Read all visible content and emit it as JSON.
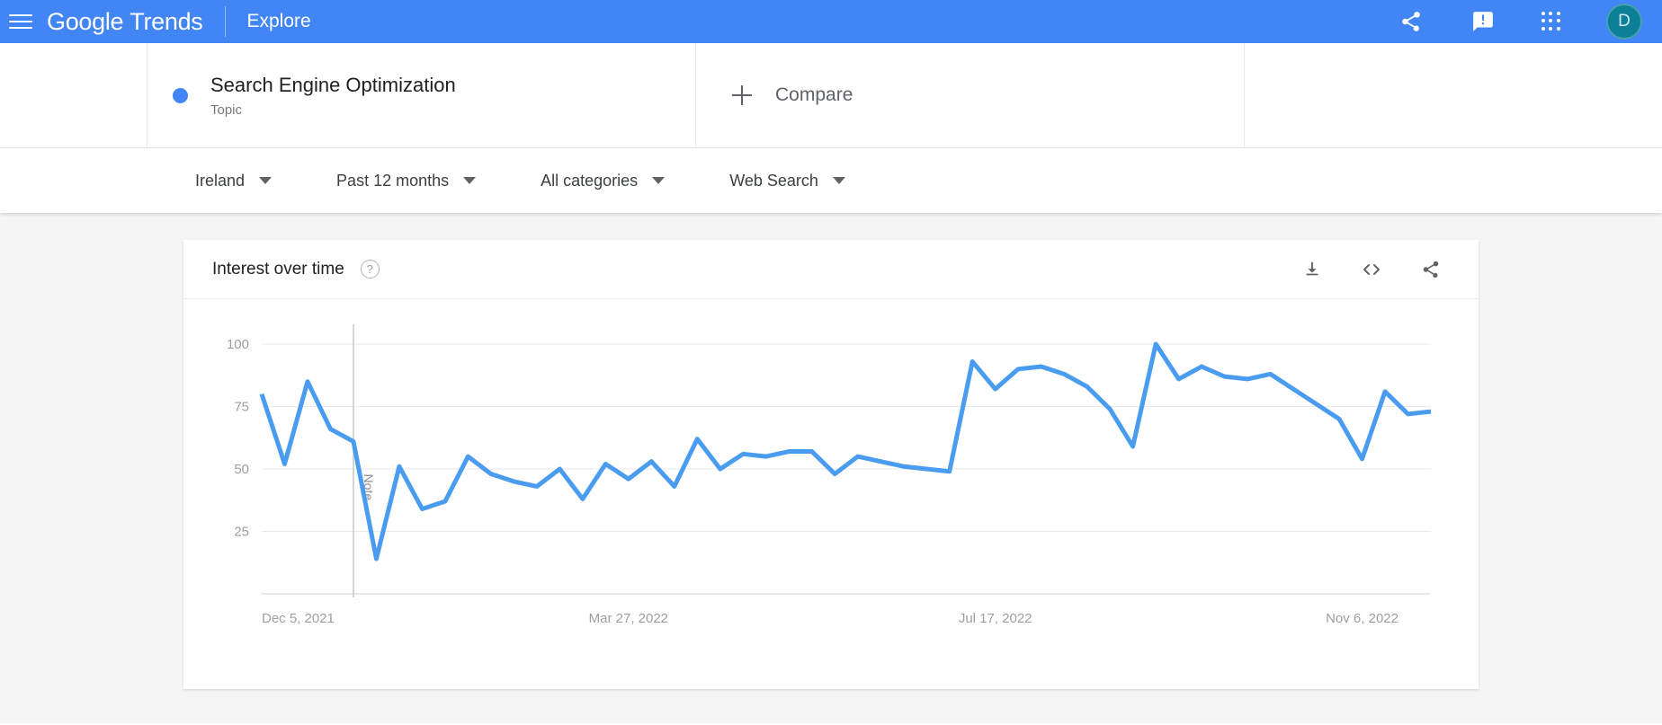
{
  "appbar": {
    "menu_icon": "hamburger-menu-icon",
    "brand_google": "Google",
    "brand_product": "Trends",
    "explore_label": "Explore",
    "share_icon": "share-icon",
    "feedback_icon": "feedback-icon",
    "apps_icon": "apps-grid-icon",
    "avatar_initial": "D",
    "background_color": "#4285f4",
    "avatar_color": "#0b8096"
  },
  "query": {
    "term_color": "#4285f4",
    "term_title": "Search Engine Optimization",
    "term_subtitle": "Topic",
    "compare_label": "Compare",
    "add_icon": "plus-icon"
  },
  "filters": [
    {
      "label": "Ireland",
      "icon": "chevron-down-icon"
    },
    {
      "label": "Past 12 months",
      "icon": "chevron-down-icon"
    },
    {
      "label": "All categories",
      "icon": "chevron-down-icon"
    },
    {
      "label": "Web Search",
      "icon": "chevron-down-icon"
    }
  ],
  "card": {
    "title": "Interest over time",
    "help_icon": "help-circle-icon",
    "help_glyph": "?",
    "download_icon": "download-icon",
    "embed_icon": "embed-code-icon",
    "share_icon": "share-icon"
  },
  "chart_data": {
    "type": "line",
    "title": "Interest over time",
    "xlabel": "",
    "ylabel": "",
    "ylim": [
      0,
      100
    ],
    "yticks": [
      100,
      75,
      50,
      25
    ],
    "grid": true,
    "legend": false,
    "line_color": "#4a9cf0",
    "xticks": [
      "Dec 5, 2021",
      "Mar 27, 2022",
      "Jul 17, 2022",
      "Nov 6, 2022"
    ],
    "xtick_indices": [
      0,
      16,
      32,
      48
    ],
    "annotation": {
      "label": "Note",
      "index": 4
    },
    "x": [
      "Dec 5, 2021",
      "Dec 12, 2021",
      "Dec 19, 2021",
      "Dec 26, 2021",
      "Jan 2, 2022",
      "Jan 9, 2022",
      "Jan 16, 2022",
      "Jan 23, 2022",
      "Jan 30, 2022",
      "Feb 6, 2022",
      "Feb 13, 2022",
      "Feb 20, 2022",
      "Feb 27, 2022",
      "Mar 6, 2022",
      "Mar 13, 2022",
      "Mar 20, 2022",
      "Mar 27, 2022",
      "Apr 3, 2022",
      "Apr 10, 2022",
      "Apr 17, 2022",
      "Apr 24, 2022",
      "May 1, 2022",
      "May 8, 2022",
      "May 15, 2022",
      "May 22, 2022",
      "May 29, 2022",
      "Jun 5, 2022",
      "Jun 12, 2022",
      "Jun 19, 2022",
      "Jun 26, 2022",
      "Jul 3, 2022",
      "Jul 10, 2022",
      "Jul 17, 2022",
      "Jul 24, 2022",
      "Jul 31, 2022",
      "Aug 7, 2022",
      "Aug 14, 2022",
      "Aug 21, 2022",
      "Aug 28, 2022",
      "Sep 4, 2022",
      "Sep 11, 2022",
      "Sep 18, 2022",
      "Sep 25, 2022",
      "Oct 2, 2022",
      "Oct 9, 2022",
      "Oct 16, 2022",
      "Oct 23, 2022",
      "Oct 30, 2022",
      "Nov 6, 2022",
      "Nov 13, 2022",
      "Nov 20, 2022",
      "Nov 27, 2022"
    ],
    "values": [
      80,
      52,
      85,
      66,
      61,
      14,
      51,
      34,
      37,
      55,
      48,
      45,
      43,
      50,
      38,
      52,
      46,
      53,
      43,
      62,
      50,
      56,
      55,
      57,
      57,
      48,
      55,
      53,
      51,
      50,
      49,
      93,
      82,
      90,
      91,
      88,
      83,
      74,
      59,
      100,
      86,
      91,
      87,
      86,
      88,
      82,
      76,
      70,
      54,
      81,
      72,
      73
    ],
    "series": [
      {
        "name": "Search Engine Optimization",
        "color": "#4a9cf0",
        "values": [
          80,
          52,
          85,
          66,
          61,
          14,
          51,
          34,
          37,
          55,
          48,
          45,
          43,
          50,
          38,
          52,
          46,
          53,
          43,
          62,
          50,
          56,
          55,
          57,
          57,
          48,
          55,
          53,
          51,
          50,
          49,
          93,
          82,
          90,
          91,
          88,
          83,
          74,
          59,
          100,
          86,
          91,
          87,
          86,
          88,
          82,
          76,
          70,
          54,
          81,
          72,
          73
        ]
      }
    ]
  }
}
